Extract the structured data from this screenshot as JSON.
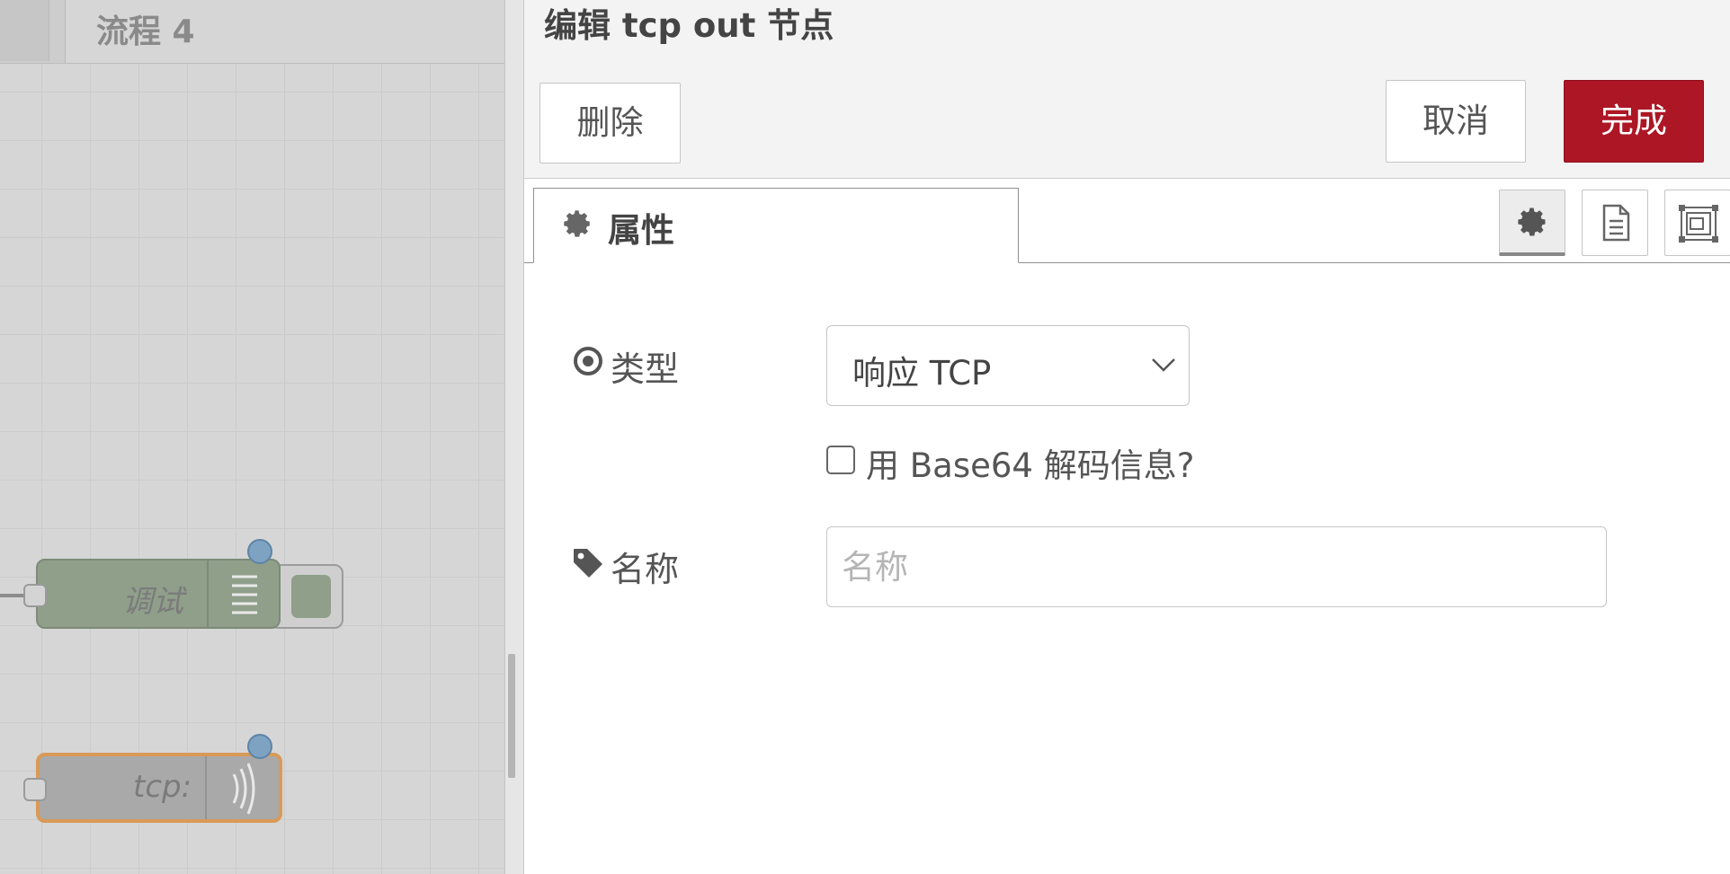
{
  "workspace": {
    "flow_tab_label": "流程 4",
    "nodes": [
      {
        "label": "调试",
        "color": "#8f9f8a",
        "type": "debug"
      },
      {
        "label": "tcp:",
        "color": "#a9a9a9",
        "type": "tcp-out",
        "selected": true
      }
    ]
  },
  "tray": {
    "title": "编辑 tcp out 节点",
    "delete_label": "删除",
    "cancel_label": "取消",
    "done_label": "完成",
    "tab_properties_label": "属性",
    "form": {
      "type_label": "类型",
      "type_value": "响应 TCP",
      "base64_label": "用 Base64 解码信息?",
      "base64_checked": false,
      "name_label": "名称",
      "name_placeholder": "名称",
      "name_value": ""
    }
  },
  "colors": {
    "primary": "#ad1625",
    "status_dot": "#7ea2c2",
    "selected_border": "#d89a58"
  },
  "icons": [
    "gear-icon",
    "document-icon",
    "expand-icon",
    "radio-target-icon",
    "tag-icon",
    "chevron-down-icon",
    "list-icon",
    "wave-icon"
  ]
}
